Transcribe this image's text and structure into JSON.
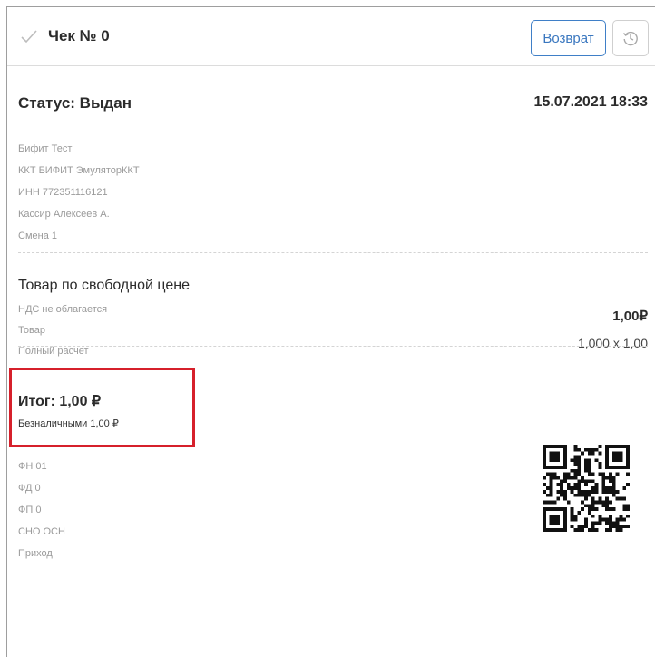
{
  "header": {
    "title": "Чек № 0",
    "return_label": "Возврат"
  },
  "status": "Статус: Выдан",
  "datetime": "15.07.2021 18:33",
  "info": [
    "Бифит Тест",
    "ККТ БИФИТ ЭмуляторККТ",
    "ИНН 772351116121",
    "Кассир Алексеев А.",
    "Смена 1"
  ],
  "item": {
    "name": "Товар по свободной цене",
    "details": [
      "НДС не облагается",
      "Товар",
      "Полный расчет"
    ],
    "price": "1,00₽",
    "quantity": "1,000 x 1,00"
  },
  "total": {
    "label": "Итог: 1,00 ₽",
    "payment": "Безналичными 1,00 ₽"
  },
  "fiscal": [
    "ФН 01",
    "ФД 0",
    "ФП 0",
    "СНО ОСН",
    "Приход"
  ],
  "colors": {
    "accent": "#3a77bf",
    "highlight": "#d6202b",
    "muted": "#9a9a9a"
  },
  "icons": [
    "check-icon",
    "history-icon",
    "qr-code"
  ]
}
